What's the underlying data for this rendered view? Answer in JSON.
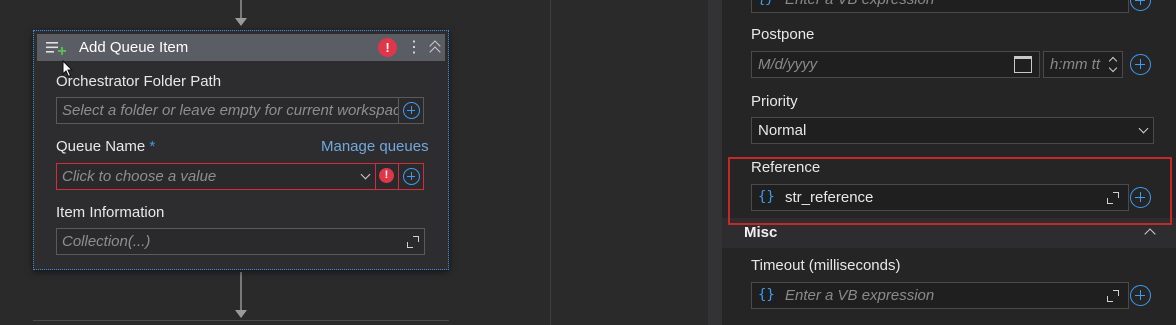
{
  "activity": {
    "title": "Add Queue Item",
    "error_badge": "!",
    "kebab": "⋮",
    "folder_path": {
      "label": "Orchestrator Folder Path",
      "placeholder": "Select a folder or leave empty for current workspace"
    },
    "queue_name": {
      "label": "Queue Name",
      "required": "*",
      "link": "Manage queues",
      "placeholder": "Click to choose a value"
    },
    "item_information": {
      "label": "Item Information",
      "value": "Collection(...)"
    }
  },
  "properties": {
    "top_field": {
      "brace": "{}",
      "placeholder": "Enter a VB expression"
    },
    "postpone": {
      "label": "Postpone",
      "date_placeholder": "M/d/yyyy",
      "time_placeholder": "h:mm tt"
    },
    "priority": {
      "label": "Priority",
      "value": "Normal"
    },
    "reference": {
      "label": "Reference",
      "brace": "{}",
      "value": "str_reference"
    },
    "misc_section": {
      "title": "Misc"
    },
    "timeout": {
      "label": "Timeout (milliseconds)",
      "brace": "{}",
      "placeholder": "Enter a VB expression"
    }
  },
  "colors": {
    "accent": "#3e9bf0",
    "error": "#e0364a",
    "highlight_box": "#c4282b",
    "link": "#70a8dc"
  },
  "icons": [
    "add-queue-item-icon",
    "error-icon",
    "more-options-icon",
    "collapse-icon",
    "plus-icon",
    "chevron-down-icon",
    "expand-icon",
    "calendar-icon",
    "spinner-icon",
    "chevron-up-icon",
    "mouse-cursor-icon"
  ]
}
